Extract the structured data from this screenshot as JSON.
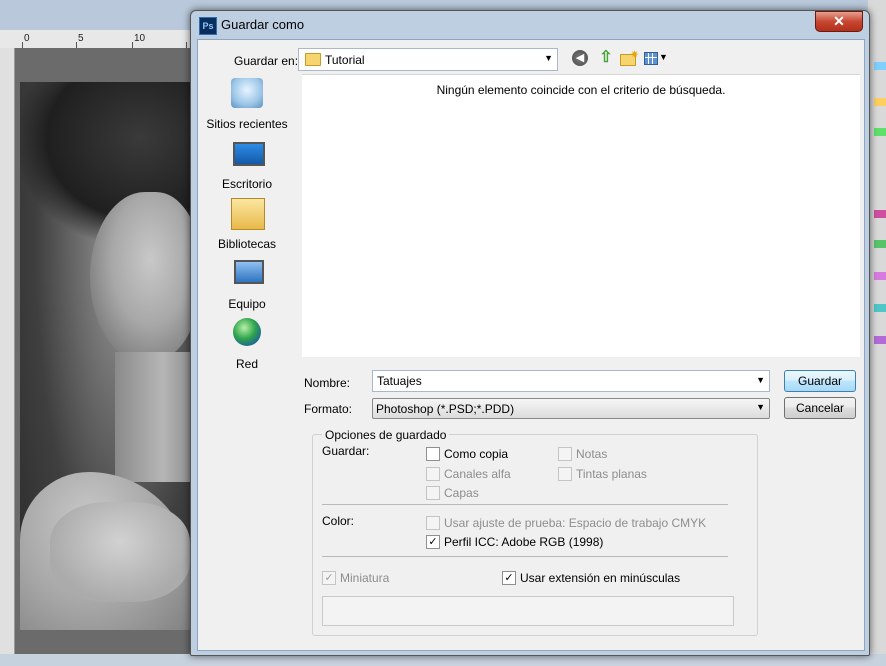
{
  "ruler": {
    "ticks": [
      "0",
      "5",
      "10"
    ]
  },
  "dialog": {
    "title": "Guardar como",
    "app_icon_text": "Ps",
    "close_glyph": "✕",
    "save_in": {
      "label": "Guardar en:",
      "value": "Tutorial"
    },
    "places": [
      {
        "label": "Sitios recientes",
        "icon": "recent-places-icon"
      },
      {
        "label": "Escritorio",
        "icon": "desktop-icon"
      },
      {
        "label": "Bibliotecas",
        "icon": "libraries-icon"
      },
      {
        "label": "Equipo",
        "icon": "computer-icon"
      },
      {
        "label": "Red",
        "icon": "network-icon"
      }
    ],
    "file_list": {
      "empty_message": "Ningún elemento coincide con el criterio de búsqueda."
    },
    "name": {
      "label": "Nombre:",
      "value": "Tatuajes"
    },
    "format": {
      "label": "Formato:",
      "value": "Photoshop (*.PSD;*.PDD)"
    },
    "buttons": {
      "save": "Guardar",
      "cancel": "Cancelar"
    },
    "options": {
      "title": "Opciones de guardado",
      "save_label": "Guardar:",
      "as_copy": {
        "label": "Como copia",
        "checked": false,
        "enabled": true
      },
      "notes": {
        "label": "Notas",
        "checked": false,
        "enabled": false
      },
      "alpha_channels": {
        "label": "Canales alfa",
        "checked": false,
        "enabled": false
      },
      "spot_colors": {
        "label": "Tintas planas",
        "checked": false,
        "enabled": false
      },
      "layers": {
        "label": "Capas",
        "checked": false,
        "enabled": false
      },
      "color_label": "Color:",
      "proof_setup": {
        "label": "Usar ajuste de prueba: Espacio de trabajo CMYK",
        "checked": false,
        "enabled": false
      },
      "icc_profile": {
        "label": "Perfil ICC: Adobe RGB (1998)",
        "checked": true,
        "enabled": true
      },
      "thumbnail": {
        "label": "Miniatura",
        "checked": true,
        "enabled": false
      },
      "lowercase_ext": {
        "label": "Usar extensión en minúsculas",
        "checked": true,
        "enabled": true
      }
    }
  },
  "colors": {
    "title_bar": "#bfcfe2",
    "close_button": "#c74733",
    "default_button": "#bee6fd",
    "dialog_body": "#f0f0f0"
  }
}
